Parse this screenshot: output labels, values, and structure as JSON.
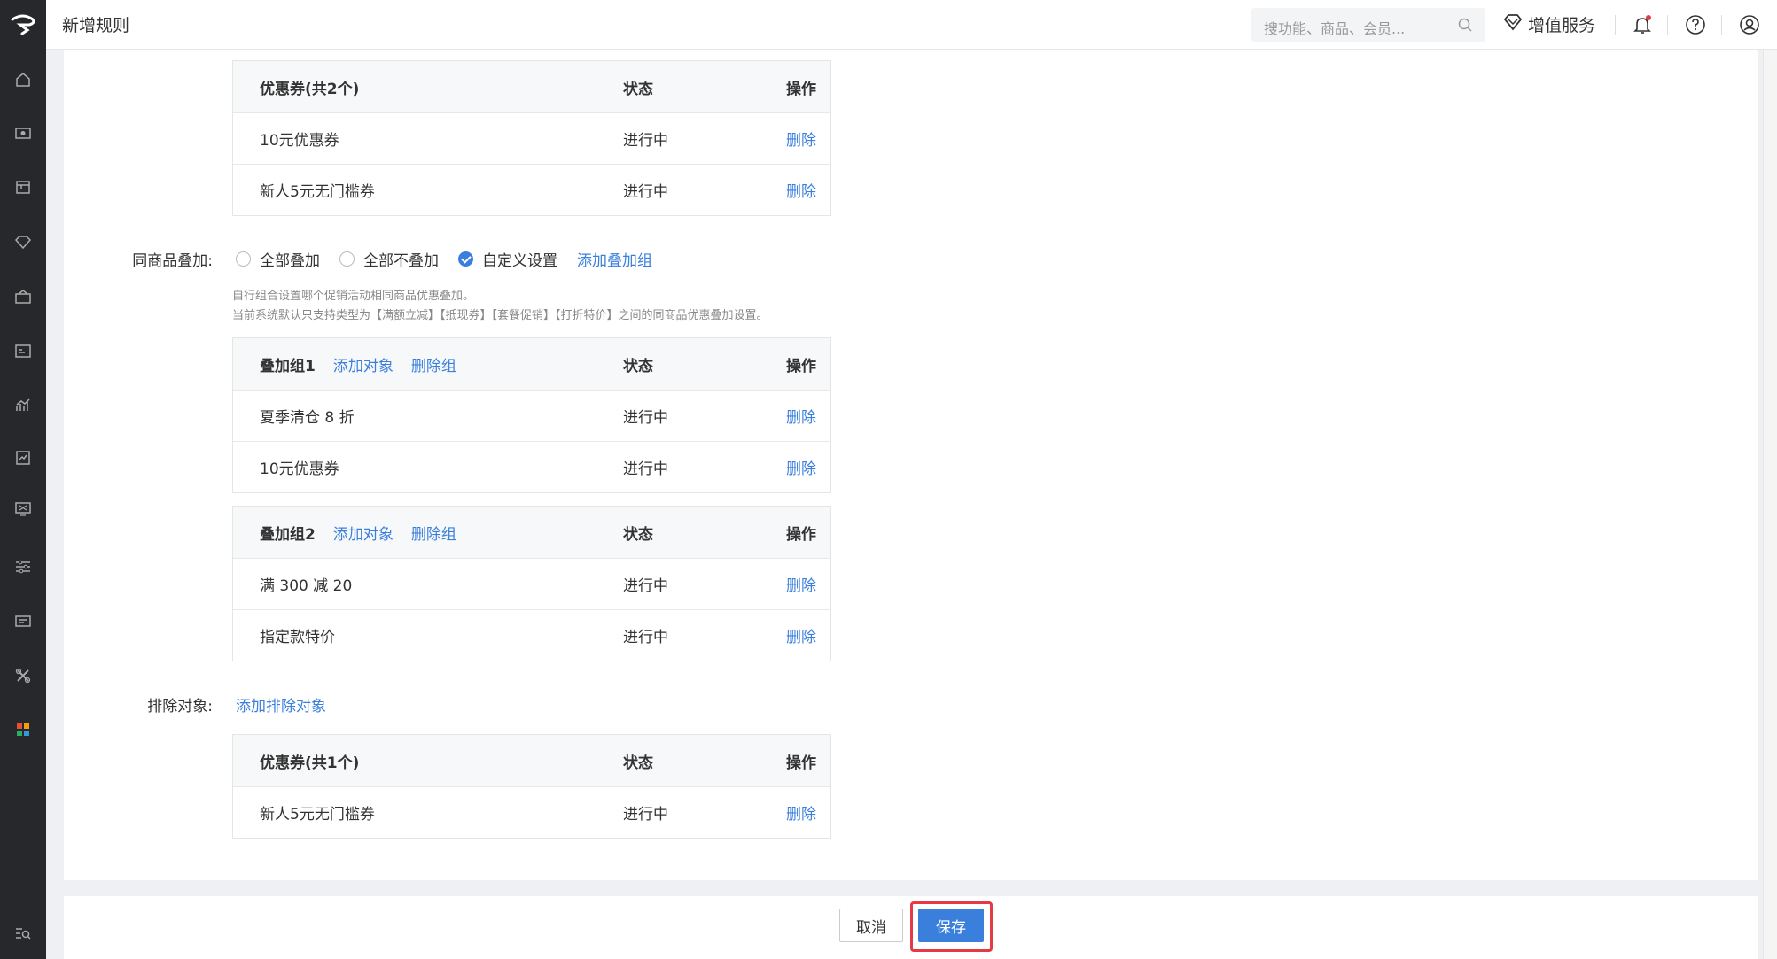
{
  "header": {
    "title": "新增规则",
    "search_placeholder": "搜功能、商品、会员...",
    "value_added_label": "增值服务"
  },
  "sidebar": {
    "icons": [
      "home-icon",
      "money-icon",
      "store-icon",
      "diamond-icon",
      "marketing-icon",
      "member-card-icon",
      "chart-icon",
      "report-icon",
      "finance-icon",
      "settings-sliders-icon",
      "message-icon",
      "tools-icon",
      "apps-icon",
      "search-list-icon"
    ]
  },
  "coupon_table": {
    "head": {
      "name": "优惠券(共2个)",
      "status": "状态",
      "action": "操作"
    },
    "rows": [
      {
        "name": "10元优惠券",
        "status": "进行中",
        "action": "删除"
      },
      {
        "name": "新人5元无门槛券",
        "status": "进行中",
        "action": "删除"
      }
    ]
  },
  "stacking": {
    "label": "同商品叠加:",
    "options": [
      "全部叠加",
      "全部不叠加",
      "自定义设置"
    ],
    "selected": "自定义设置",
    "add_group": "添加叠加组",
    "hint1": "自行组合设置哪个促销活动相同商品优惠叠加。",
    "hint2": "当前系统默认只支持类型为【满额立减】【抵现券】【套餐促销】【打折特价】之间的同商品优惠叠加设置。"
  },
  "group1": {
    "head": {
      "name": "叠加组1",
      "add": "添加对象",
      "remove": "删除组",
      "status": "状态",
      "action": "操作"
    },
    "rows": [
      {
        "name": "夏季清仓 8 折",
        "status": "进行中",
        "action": "删除"
      },
      {
        "name": "10元优惠券",
        "status": "进行中",
        "action": "删除"
      }
    ]
  },
  "group2": {
    "head": {
      "name": "叠加组2",
      "add": "添加对象",
      "remove": "删除组",
      "status": "状态",
      "action": "操作"
    },
    "rows": [
      {
        "name": "满 300 减 20",
        "status": "进行中",
        "action": "删除"
      },
      {
        "name": "指定款特价",
        "status": "进行中",
        "action": "删除"
      }
    ]
  },
  "exclude": {
    "label": "排除对象:",
    "add": "添加排除对象",
    "head": {
      "name": "优惠券(共1个)",
      "status": "状态",
      "action": "操作"
    },
    "rows": [
      {
        "name": "新人5元无门槛券",
        "status": "进行中",
        "action": "删除"
      }
    ]
  },
  "footer": {
    "cancel": "取消",
    "save": "保存"
  },
  "colors": {
    "accent": "#3b7fdc",
    "highlight": "#e63946",
    "sidebar": "#27282c"
  }
}
